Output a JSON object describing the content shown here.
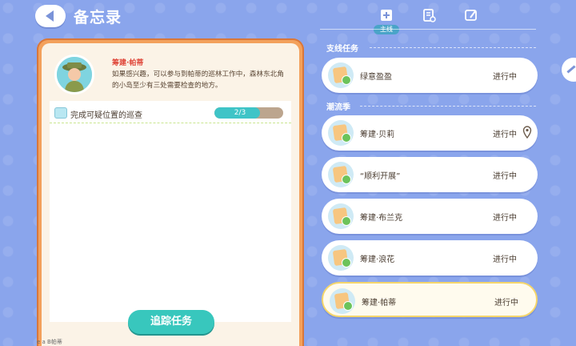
{
  "header": {
    "title": "备忘录"
  },
  "tabs": {
    "active_label": "主线",
    "items": [
      {
        "icon": "mainline-quest-icon"
      },
      {
        "icon": "document-quest-icon"
      },
      {
        "icon": "pencil-note-icon"
      }
    ]
  },
  "detail": {
    "npc_name": "筹建·帕蒂",
    "description": "如果感兴趣，可以参与到帕蒂的巡林工作中，森林东北角的小岛至少有三处需要检查的地方。",
    "task": {
      "label": "完成可疑位置的巡查",
      "progress_text": "2/3",
      "progress_fraction": 0.667
    },
    "track_button": "追踪任务",
    "bottom_text": "e   a   B帕蒂"
  },
  "sections": [
    {
      "label": "支线任务"
    },
    {
      "label": "潮流季"
    }
  ],
  "quests": [
    {
      "name": "绿意盈盈",
      "status": "进行中",
      "pinned": false,
      "selected": false
    },
    {
      "name": "筹建·贝莉",
      "status": "进行中",
      "pinned": true,
      "selected": false
    },
    {
      "name": "“顺利开展”",
      "status": "进行中",
      "pinned": false,
      "selected": false
    },
    {
      "name": "筹建·布兰克",
      "status": "进行中",
      "pinned": false,
      "selected": false
    },
    {
      "name": "筹建·浪花",
      "status": "进行中",
      "pinned": false,
      "selected": false
    },
    {
      "name": "筹建·帕蒂",
      "status": "进行中",
      "pinned": false,
      "selected": true
    }
  ],
  "colors": {
    "background": "#8aa5ec",
    "accent_teal": "#38c7bd",
    "panel_orange": "#f3a15c",
    "npc_name_red": "#e04a3d"
  }
}
